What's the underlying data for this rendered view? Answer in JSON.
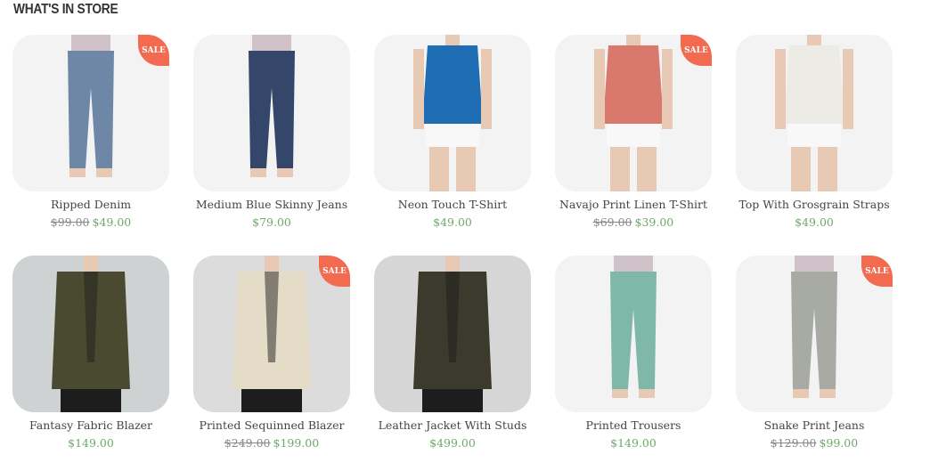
{
  "section": {
    "title": "WHAT'S IN STORE"
  },
  "products": [
    {
      "name": "Ripped Denim",
      "old_price": "$99.00",
      "price": "$49.00",
      "sale": "SALE",
      "bg": "#f3f3f3",
      "garment": "#6f87a6",
      "kind": "pants"
    },
    {
      "name": "Medium Blue Skinny Jeans",
      "old_price": "",
      "price": "$79.00",
      "sale": "",
      "bg": "#f3f3f3",
      "garment": "#34476a",
      "kind": "pants"
    },
    {
      "name": "Neon Touch T-Shirt",
      "old_price": "",
      "price": "$49.00",
      "sale": "",
      "bg": "#f3f3f3",
      "garment": "#1f6db2",
      "kind": "top"
    },
    {
      "name": "Navajo Print Linen T-Shirt",
      "old_price": "$69.00",
      "price": "$39.00",
      "sale": "SALE",
      "bg": "#f3f3f3",
      "garment": "#d9786c",
      "kind": "top"
    },
    {
      "name": "Top With Grosgrain Straps",
      "old_price": "",
      "price": "$49.00",
      "sale": "",
      "bg": "#f3f3f3",
      "garment": "#ecebe6",
      "kind": "top"
    },
    {
      "name": "Fantasy Fabric Blazer",
      "old_price": "",
      "price": "$149.00",
      "sale": "",
      "bg": "#cfd2d3",
      "garment": "#4a4a30",
      "kind": "jacket"
    },
    {
      "name": "Printed Sequinned Blazer",
      "old_price": "$249.00",
      "price": "$199.00",
      "sale": "SALE",
      "bg": "#dcdcdc",
      "garment": "#e4dcc6",
      "kind": "jacket"
    },
    {
      "name": "Leather Jacket With Studs",
      "old_price": "",
      "price": "$499.00",
      "sale": "",
      "bg": "#d6d6d6",
      "garment": "#3b3a2c",
      "kind": "jacket"
    },
    {
      "name": "Printed Trousers",
      "old_price": "",
      "price": "$149.00",
      "sale": "",
      "bg": "#f3f3f3",
      "garment": "#7fb7a8",
      "kind": "pants"
    },
    {
      "name": "Snake Print Jeans",
      "old_price": "$129.00",
      "price": "$99.00",
      "sale": "SALE",
      "bg": "#f3f3f3",
      "garment": "#a8aaa4",
      "kind": "pants"
    }
  ]
}
